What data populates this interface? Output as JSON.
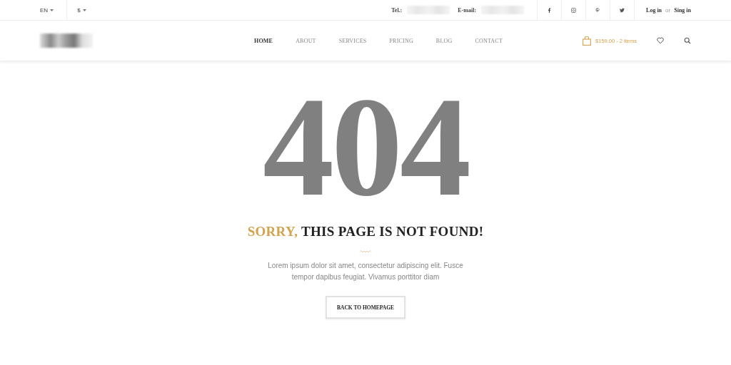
{
  "topbar": {
    "language": "EN",
    "currency": "$",
    "tel_label": "Tel.:",
    "email_label": "E-mail:",
    "login": "Log in",
    "or": "or",
    "signin": "Sing in"
  },
  "nav": {
    "items": [
      {
        "label": "HOME",
        "selected": true
      },
      {
        "label": "ABOUT",
        "selected": false
      },
      {
        "label": "SERVICES",
        "selected": false
      },
      {
        "label": "PRICING",
        "selected": false
      },
      {
        "label": "BLOG",
        "selected": false
      },
      {
        "label": "CONTACT",
        "selected": false
      }
    ],
    "cart": "$159.00 - 2 items"
  },
  "error": {
    "code": "404",
    "heading_accent": "SORRY,",
    "heading": "THIS PAGE IS NOT FOUND!",
    "message": "Lorem ipsum dolor sit amet, consectetur adipiscing elit. Fusce tempor dapibus feugiat. Vivamus porttitor diam",
    "button": "BACK TO HOMEPAGE"
  }
}
